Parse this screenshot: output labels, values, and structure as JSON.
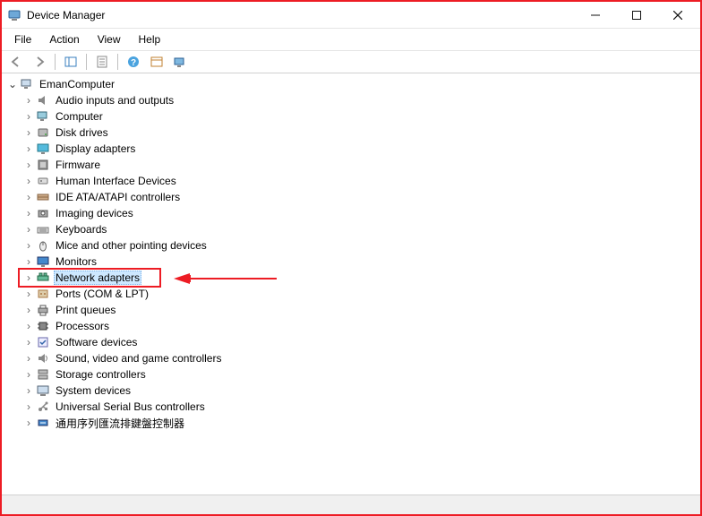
{
  "window": {
    "title": "Device Manager"
  },
  "menu": {
    "file": "File",
    "action": "Action",
    "view": "View",
    "help": "Help"
  },
  "tree": {
    "root": "EmanComputer",
    "items": [
      {
        "label": "Audio inputs and outputs",
        "icon": "audio"
      },
      {
        "label": "Computer",
        "icon": "computer"
      },
      {
        "label": "Disk drives",
        "icon": "disk"
      },
      {
        "label": "Display adapters",
        "icon": "display"
      },
      {
        "label": "Firmware",
        "icon": "firmware"
      },
      {
        "label": "Human Interface Devices",
        "icon": "hid"
      },
      {
        "label": "IDE ATA/ATAPI controllers",
        "icon": "ide"
      },
      {
        "label": "Imaging devices",
        "icon": "imaging"
      },
      {
        "label": "Keyboards",
        "icon": "keyboard"
      },
      {
        "label": "Mice and other pointing devices",
        "icon": "mouse"
      },
      {
        "label": "Monitors",
        "icon": "monitor"
      },
      {
        "label": "Network adapters",
        "icon": "network",
        "selected": true,
        "highlighted": true
      },
      {
        "label": "Ports (COM & LPT)",
        "icon": "ports"
      },
      {
        "label": "Print queues",
        "icon": "printer"
      },
      {
        "label": "Processors",
        "icon": "cpu"
      },
      {
        "label": "Software devices",
        "icon": "software"
      },
      {
        "label": "Sound, video and game controllers",
        "icon": "sound"
      },
      {
        "label": "Storage controllers",
        "icon": "storage"
      },
      {
        "label": "System devices",
        "icon": "system"
      },
      {
        "label": "Universal Serial Bus controllers",
        "icon": "usb"
      },
      {
        "label": "通用序列匯流排鍵盤控制器",
        "icon": "usb2"
      }
    ]
  },
  "annotation": {
    "arrow_color": "#ed1c24"
  }
}
